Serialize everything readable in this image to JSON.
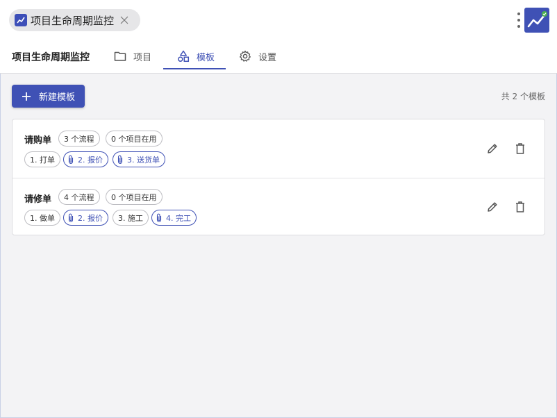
{
  "app_chip": {
    "label": "项目生命周期监控"
  },
  "nav": {
    "title": "项目生命周期监控",
    "tabs": [
      {
        "label": "项目",
        "icon": "folder-icon",
        "active": false
      },
      {
        "label": "模板",
        "icon": "shapes-icon",
        "active": true
      },
      {
        "label": "设置",
        "icon": "gear-icon",
        "active": false
      }
    ]
  },
  "toolbar": {
    "new_label": "新建模板",
    "count_text": "共 2 个模板"
  },
  "templates": [
    {
      "name": "请购单",
      "flow_count": "3 个流程",
      "in_use": "0 个项目在用",
      "steps": [
        {
          "label": "1. 打单",
          "attachment": false
        },
        {
          "label": "2. 报价",
          "attachment": true
        },
        {
          "label": "3. 送货单",
          "attachment": true
        }
      ]
    },
    {
      "name": "请修单",
      "flow_count": "4 个流程",
      "in_use": "0 个项目在用",
      "steps": [
        {
          "label": "1. 做单",
          "attachment": false
        },
        {
          "label": "2. 报价",
          "attachment": true
        },
        {
          "label": "3. 施工",
          "attachment": false
        },
        {
          "label": "4. 完工",
          "attachment": true
        }
      ]
    }
  ],
  "colors": {
    "accent": "#3f51b5",
    "background": "#f3f3f5",
    "badge_check": "#4caf50"
  }
}
